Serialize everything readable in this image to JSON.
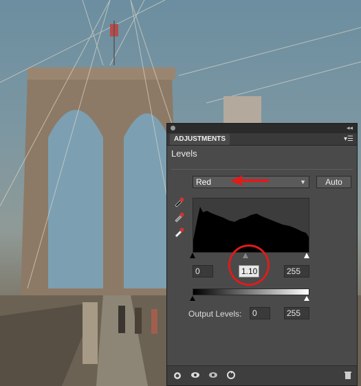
{
  "panel": {
    "tab_label": "ADJUSTMENTS",
    "heading": "Levels",
    "channel": "Red",
    "auto_label": "Auto",
    "input_black": "0",
    "input_gamma": "1.10",
    "input_white": "255",
    "output_label": "Output Levels:",
    "output_black": "0",
    "output_white": "255"
  },
  "icons": {
    "menu": "panel-menu-icon",
    "eyedroppers": [
      "black-eyedropper-icon",
      "gray-eyedropper-icon",
      "white-eyedropper-icon"
    ],
    "bottom": [
      "clip-icon",
      "view-previous-icon",
      "visibility-eye-icon",
      "reset-icon",
      "trash-icon"
    ]
  },
  "colors": {
    "annotation": "#e01b1b",
    "panel_bg": "#4a4a4a"
  }
}
